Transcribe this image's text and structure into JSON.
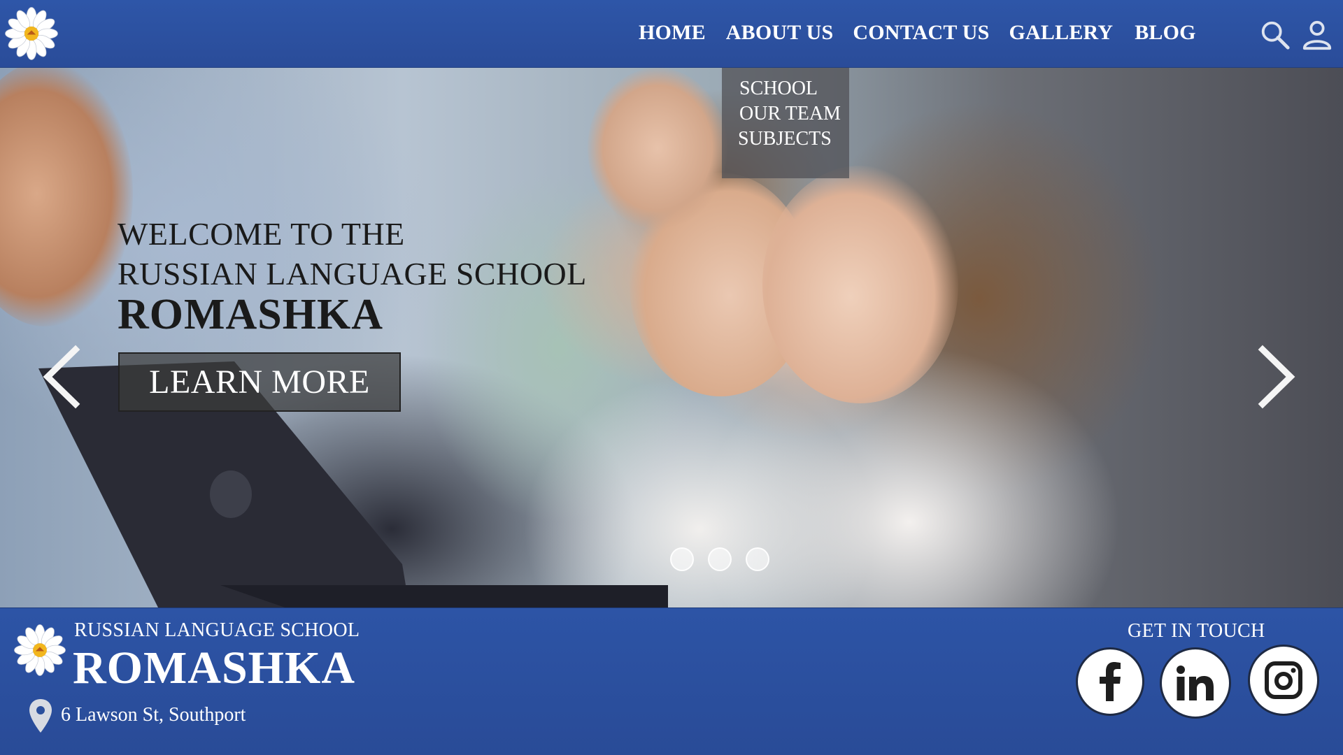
{
  "header": {
    "logo_icon": "daisy-logo-icon",
    "nav": [
      "HOME",
      "ABOUT US",
      "CONTACT US",
      "GALLERY",
      "BLOG"
    ],
    "icons": [
      "search-icon",
      "user-icon"
    ]
  },
  "dropdown": {
    "parent": "ABOUT US",
    "items": [
      "SCHOOL",
      "OUR TEAM",
      "SUBJECTS"
    ]
  },
  "hero": {
    "line1": "WELCOME TO THE",
    "line2": "RUSSIAN LANGUAGE SCHOOL",
    "line3": "ROMASHKA",
    "button": "LEARN MORE",
    "slides_total": 3,
    "prev_icon": "chevron-left-icon",
    "next_icon": "chevron-right-icon"
  },
  "footer": {
    "subtitle": "RUSSIAN LANGUAGE SCHOOL",
    "title": "ROMASHKA",
    "address": "6 Lawson St, Southport",
    "get_in_touch": "GET IN TOUCH",
    "social": [
      "facebook-icon",
      "linkedin-icon",
      "instagram-icon"
    ]
  },
  "colors": {
    "brand_blue": "#2b4f9c",
    "text_dark": "#1a1a1a",
    "white": "#ffffff"
  }
}
